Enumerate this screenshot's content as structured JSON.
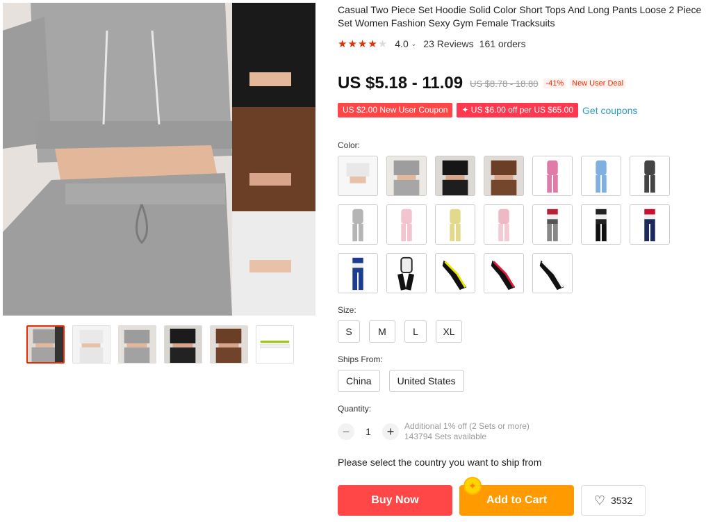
{
  "product": {
    "title": "Casual Two Piece Set Hoodie Solid Color Short Tops And Long Pants Loose 2 Piece Set Women Fashion Sexy Gym Female Tracksuits",
    "rating": "4.0",
    "rating_stars": 4,
    "reviews": "23 Reviews",
    "orders": "161 orders"
  },
  "price": {
    "current": "US $5.18 - 11.09",
    "original": "US $8.78 - 18.80",
    "discount": "-41%",
    "deal": "New User Deal"
  },
  "coupons": {
    "items": [
      "US $2.00 New User Coupon",
      "✦ US $6.00 off per US $65.00"
    ],
    "link": "Get coupons"
  },
  "color": {
    "label": "Color:",
    "swatch_icons": [
      "grey-crop-hoodie",
      "grey-hoodie-set",
      "black-hoodie-set",
      "brown-hoodie-set",
      "pink-tracksuit",
      "blue-tracksuit",
      "charcoal-tracksuit",
      "grey-tracksuit",
      "light-pink-tracksuit",
      "yellow-tracksuit",
      "pink-red-tracksuit",
      "striped-grey-tracksuit",
      "black-white-tracksuit",
      "navy-red-tracksuit",
      "blue-striped-tracksuit",
      "black-white-patch-tracksuit",
      "black-yellow-stripe-tracksuit",
      "black-red-stripe-tracksuit",
      "black-white-stripe-tracksuit"
    ]
  },
  "size": {
    "label": "Size:",
    "options": [
      "S",
      "M",
      "L",
      "XL"
    ]
  },
  "ships_from": {
    "label": "Ships From:",
    "options": [
      "China",
      "United States"
    ]
  },
  "quantity": {
    "label": "Quantity:",
    "value": "1",
    "minus": "−",
    "plus": "+",
    "note1": "Additional 1% off (2 Sets or more)",
    "note2": "143794 Sets available"
  },
  "ship_note": "Please select the country you want to ship from",
  "actions": {
    "buy": "Buy Now",
    "cart": "Add to Cart",
    "wishlist_count": "3532"
  },
  "gallery": {
    "thumb_count": 6,
    "active_index": 0
  },
  "colors": {
    "accent_red": "#ff4747",
    "cart_orange": "#ff9a00",
    "link_blue": "#2e9cc3"
  }
}
